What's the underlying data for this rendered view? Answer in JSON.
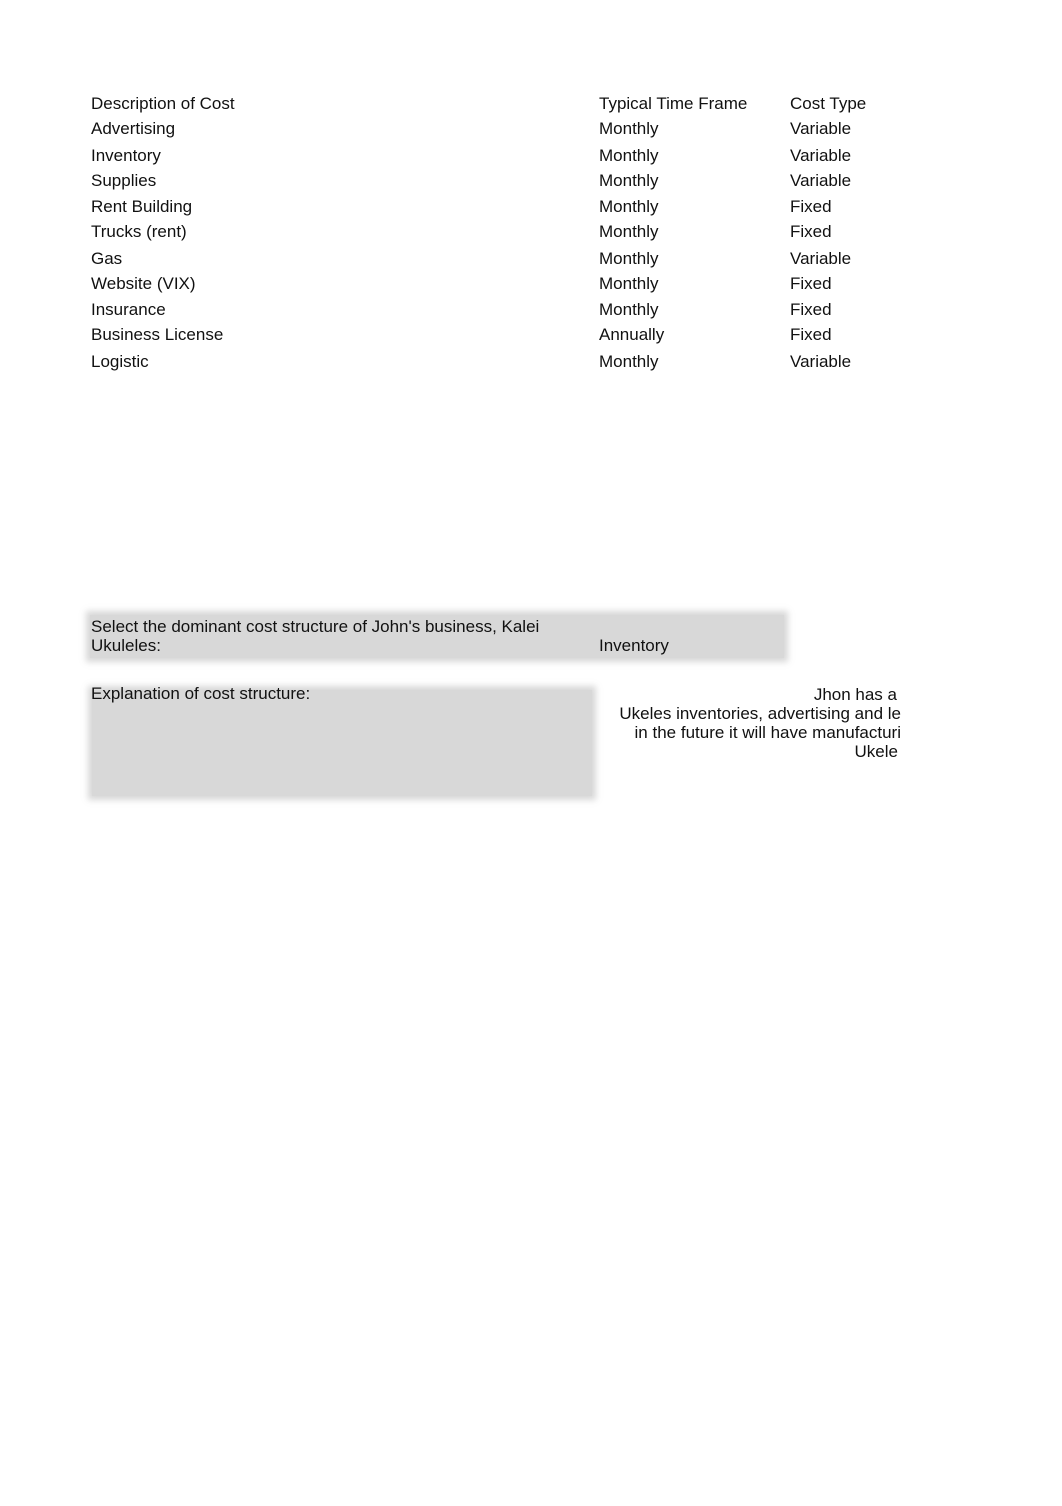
{
  "table": {
    "headers": {
      "description": "Description of Cost",
      "time_frame": "Typical Time Frame",
      "cost_type": "Cost Type"
    },
    "rows": [
      {
        "description": "Advertising",
        "time_frame": "Monthly",
        "cost_type": "Variable"
      },
      {
        "description": "Inventory",
        "time_frame": "Monthly",
        "cost_type": "Variable"
      },
      {
        "description": "Supplies",
        "time_frame": "Monthly",
        "cost_type": "Variable"
      },
      {
        "description": "Rent Building",
        "time_frame": "Monthly",
        "cost_type": "Fixed"
      },
      {
        "description": "Trucks (rent)",
        "time_frame": "Monthly",
        "cost_type": "Fixed"
      },
      {
        "description": "Gas",
        "time_frame": "Monthly",
        "cost_type": "Variable"
      },
      {
        "description": "Website (VIX)",
        "time_frame": "Monthly",
        "cost_type": "Fixed"
      },
      {
        "description": "Insurance",
        "time_frame": "Monthly",
        "cost_type": "Fixed"
      },
      {
        "description": "Business License",
        "time_frame": "Annually",
        "cost_type": "Fixed"
      },
      {
        "description": "Logistic",
        "time_frame": "Monthly",
        "cost_type": "Variable"
      }
    ]
  },
  "dominant": {
    "prompt_line1": "Select the dominant cost structure of John's business, Kalei",
    "prompt_line2": "Ukuleles:",
    "answer": "Inventory"
  },
  "explanation": {
    "label": "Explanation of cost structure:",
    "lines": [
      "Jhon has a",
      "Ukeles inventories, advertising and le",
      "in the future it will have manufacturi",
      "Ukele"
    ]
  }
}
